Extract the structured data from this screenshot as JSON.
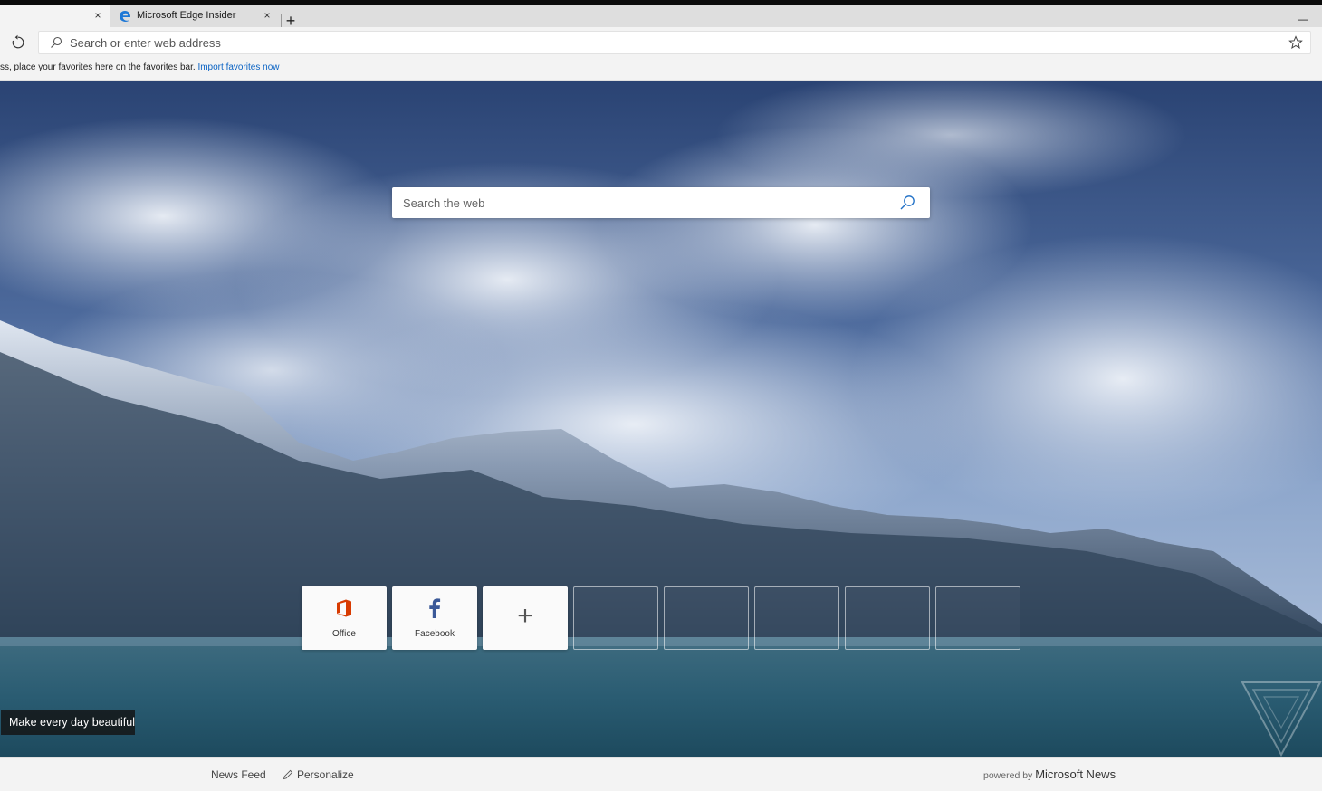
{
  "browser": {
    "tabs": [
      {
        "title": "",
        "active": true
      },
      {
        "title": "Microsoft Edge Insider",
        "active": false
      }
    ],
    "new_tab_glyph": "+",
    "close_glyph": "×",
    "minimize_glyph": "—",
    "address_placeholder": "Search or enter web address"
  },
  "favorites_bar": {
    "message": "ss, place your favorites here on the favorites bar.",
    "link": "Import favorites now"
  },
  "new_tab_page": {
    "search_placeholder": "Search the web",
    "tiles": [
      {
        "label": "Office",
        "icon": "office-icon"
      },
      {
        "label": "Facebook",
        "icon": "facebook-icon"
      },
      {
        "label": "",
        "icon": "plus-icon"
      }
    ],
    "empty_tiles": 5,
    "caption": "Make every day beautiful"
  },
  "bottom_bar": {
    "news_feed": "News Feed",
    "personalize": "Personalize",
    "powered_by": "powered by",
    "brand": "Microsoft News"
  },
  "colors": {
    "link": "#0a63c4",
    "office_orange": "#d83b01",
    "facebook_blue": "#3b5998",
    "edge_blue": "#1e78d6"
  }
}
